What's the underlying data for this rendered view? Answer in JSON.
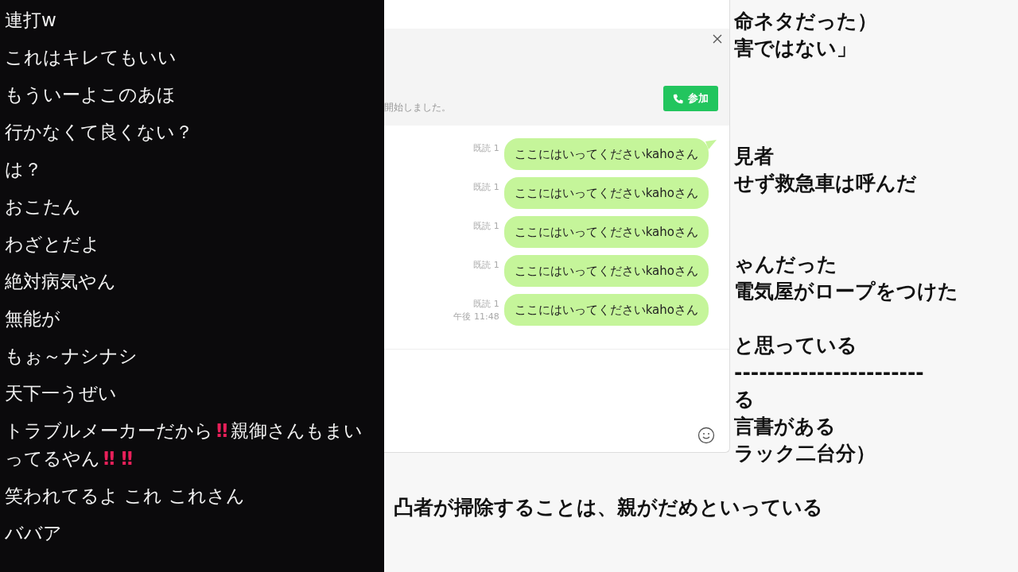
{
  "chat": [
    {
      "parts": [
        {
          "kind": "text",
          "text": "連打w"
        }
      ]
    },
    {
      "parts": [
        {
          "kind": "text",
          "text": "これはキレてもいい"
        }
      ]
    },
    {
      "parts": [
        {
          "kind": "text",
          "text": "もういーよこのあほ"
        }
      ]
    },
    {
      "parts": [
        {
          "kind": "text",
          "text": "行かなくて良くない？"
        }
      ]
    },
    {
      "parts": [
        {
          "kind": "text",
          "text": "は？"
        }
      ]
    },
    {
      "parts": [
        {
          "kind": "text",
          "text": "おこたん"
        }
      ]
    },
    {
      "parts": [
        {
          "kind": "text",
          "text": "わざとだよ"
        }
      ]
    },
    {
      "parts": [
        {
          "kind": "text",
          "text": "絶対病気やん"
        }
      ]
    },
    {
      "parts": [
        {
          "kind": "text",
          "text": "無能が"
        }
      ]
    },
    {
      "parts": [
        {
          "kind": "text",
          "text": "もぉ～ナシナシ"
        }
      ]
    },
    {
      "parts": [
        {
          "kind": "text",
          "text": "天下一うぜい"
        }
      ]
    },
    {
      "parts": [
        {
          "kind": "text",
          "text": "トラブルメーカーだから"
        },
        {
          "kind": "emoji",
          "text": "‼"
        },
        {
          "kind": "text",
          "text": "親御さんもまいってるやん"
        },
        {
          "kind": "emoji",
          "text": "‼"
        },
        {
          "kind": "emoji",
          "text": "‼"
        }
      ]
    },
    {
      "parts": [
        {
          "kind": "text",
          "text": "笑われてるよ これ これさん"
        }
      ]
    },
    {
      "parts": [
        {
          "kind": "text",
          "text": "ババア"
        }
      ]
    }
  ],
  "line_window": {
    "banner": {
      "notice": "開始しました。",
      "join_button": "参加"
    },
    "messages": [
      {
        "read": "既読 1",
        "text": "ここにはいってくださいkahoさん"
      },
      {
        "read": "既読 1",
        "text": "ここにはいってくださいkahoさん"
      },
      {
        "read": "既読 1",
        "text": "ここにはいってくださいkahoさん"
      },
      {
        "read": "既読 1",
        "text": "ここにはいってくださいkahoさん"
      },
      {
        "read": "既読 1",
        "time": "午後 11:48",
        "text": "ここにはいってくださいkahoさん"
      }
    ]
  },
  "document": {
    "paragraphs": [
      {
        "kind": "covered",
        "lines": [
          "命ネタだった）",
          "害ではない」"
        ]
      },
      {
        "kind": "covered",
        "lines": [
          "見者",
          "せず救急車は呼んだ"
        ]
      },
      {
        "kind": "covered",
        "lines": [
          "ゃんだった",
          "電気屋がロープをつけた"
        ]
      },
      {
        "kind": "covered",
        "lines": [
          "と思っている",
          "-----------------------",
          "る",
          "言書がある",
          "ラック二台分）"
        ]
      },
      {
        "kind": "open",
        "lines": [
          "凸者が掃除することは、親がだめといっている"
        ]
      }
    ]
  }
}
